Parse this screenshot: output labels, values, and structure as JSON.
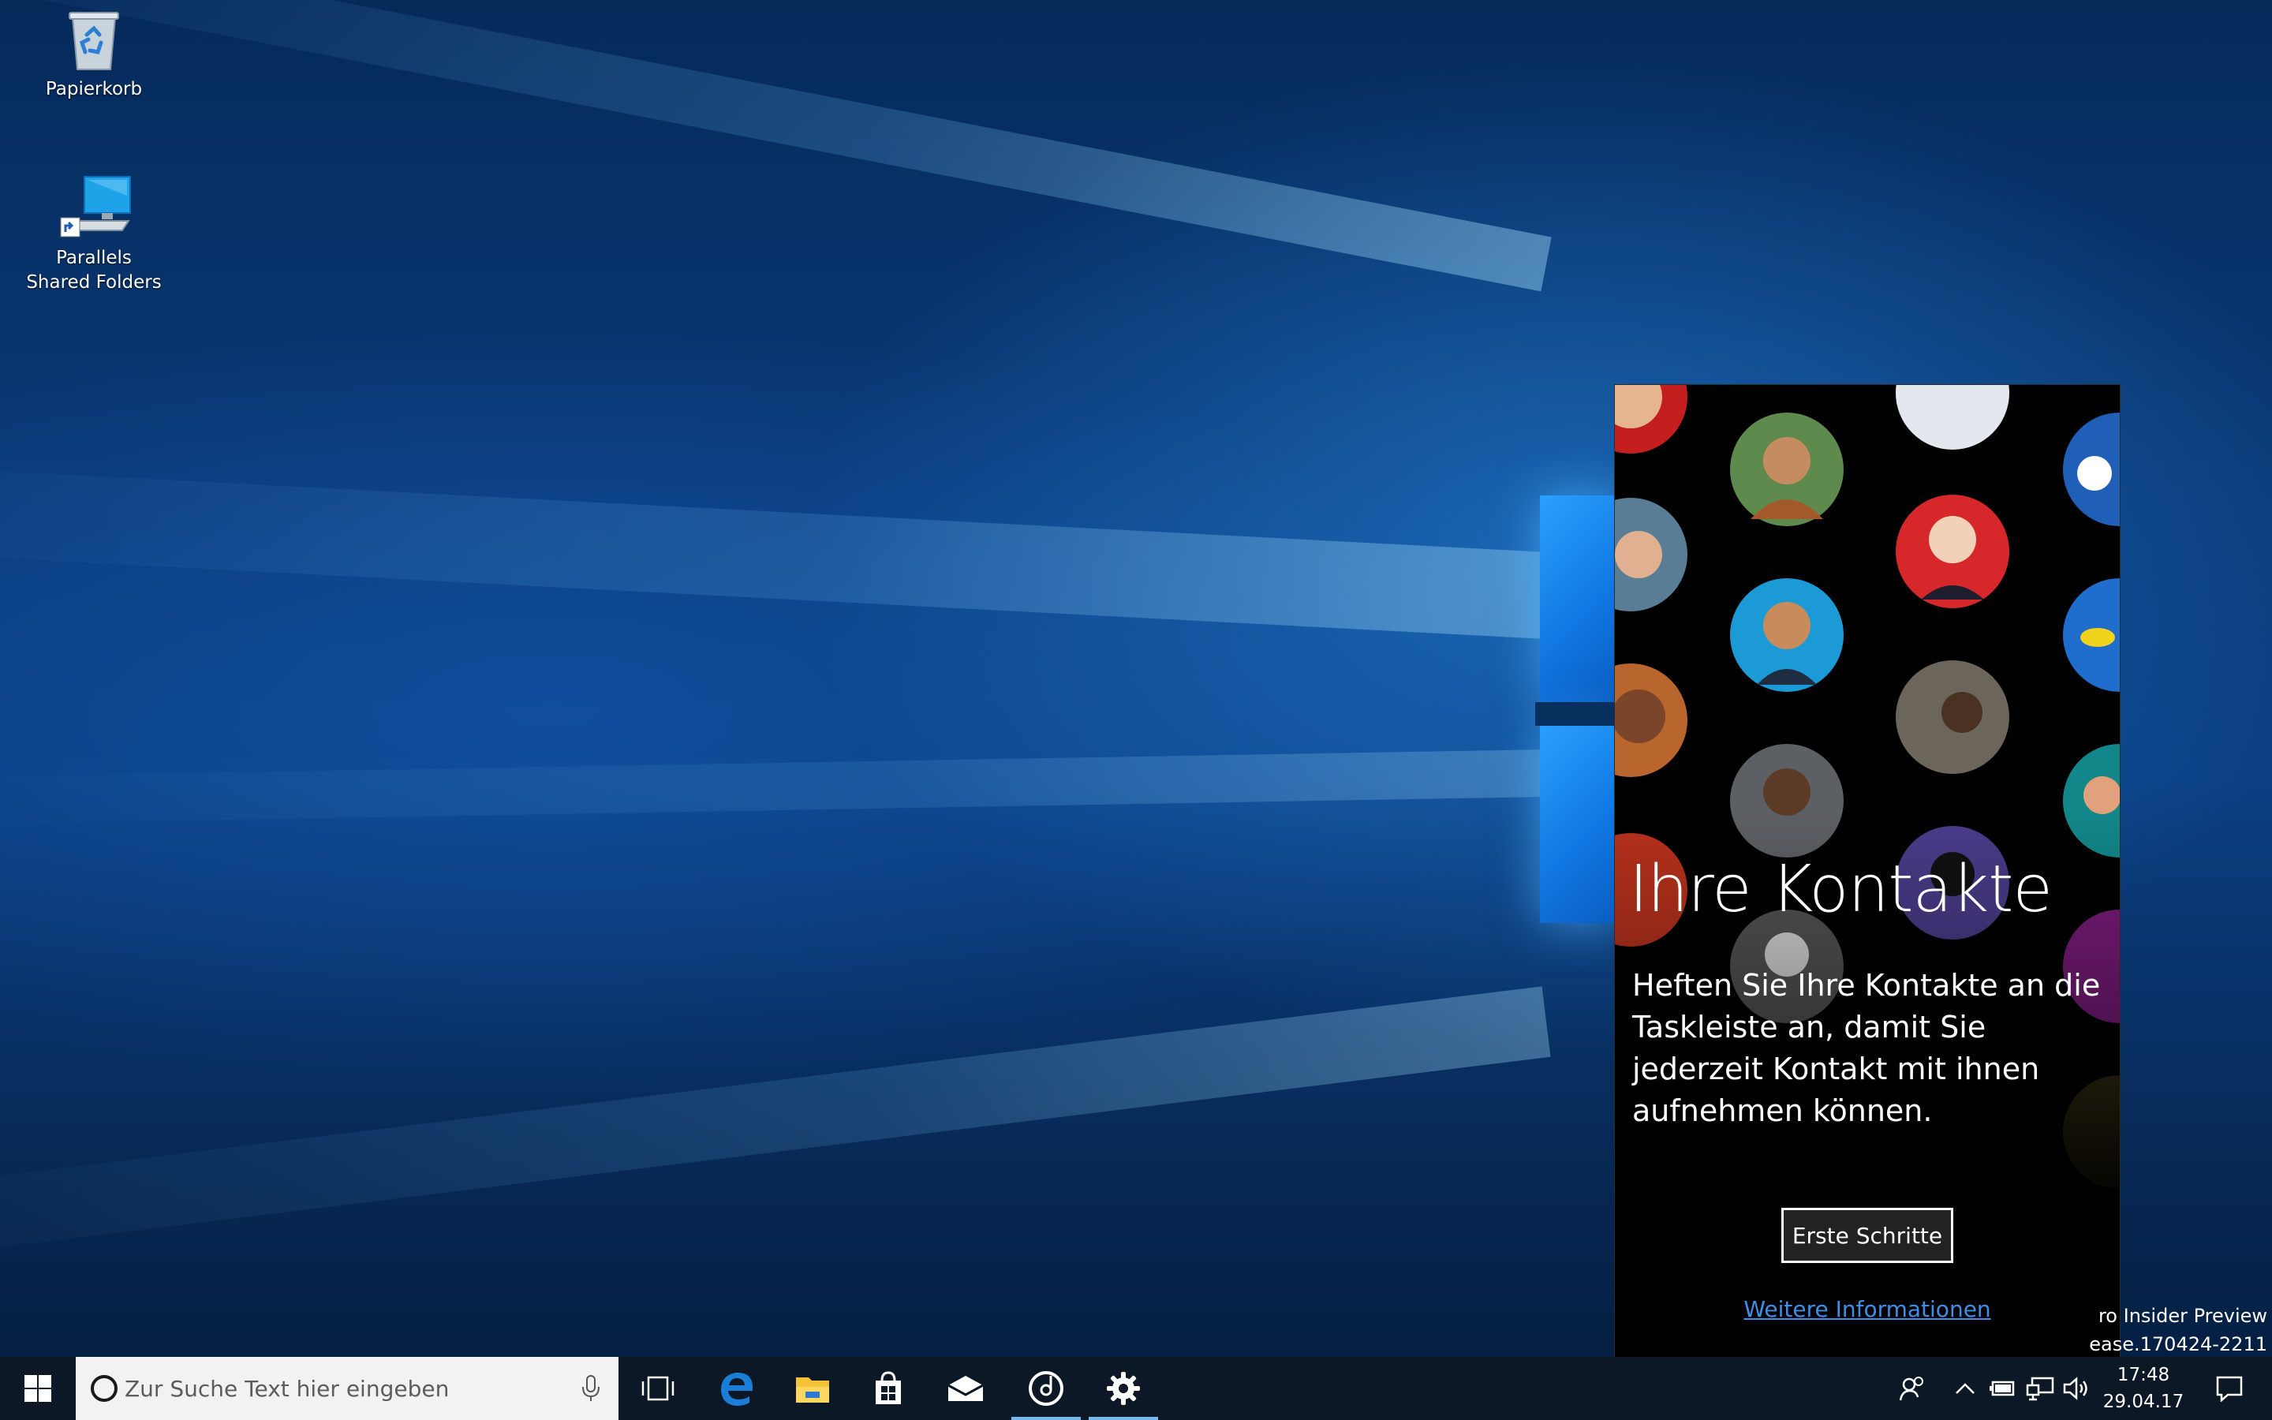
{
  "desktop": {
    "icons": [
      {
        "label": "Papierkorb",
        "icon": "recycle-bin-icon"
      },
      {
        "label": "Parallels Shared Folders",
        "icon": "shared-folders-icon"
      }
    ]
  },
  "people_flyout": {
    "title": "Ihre Kontakte",
    "description": "Heften Sie Ihre Kontakte an die Taskleiste an, damit Sie jederzeit Kontakt mit ihnen aufnehmen können.",
    "primary_button": "Erste Schritte",
    "link": "Weitere Informationen"
  },
  "watermark": {
    "line1": "ro Insider Preview",
    "line2": "ease.170424-2211"
  },
  "taskbar": {
    "search_placeholder": "Zur Suche Text hier eingeben",
    "pinned_apps": [
      "start-icon",
      "task-view-icon",
      "edge-icon",
      "file-explorer-icon",
      "store-icon",
      "mail-icon",
      "groove-music-icon",
      "settings-icon"
    ],
    "active_apps": [
      "groove-music-icon",
      "settings-icon"
    ],
    "tray_icons": [
      "people-icon",
      "chevron-up-icon",
      "battery-icon",
      "network-icon",
      "volume-icon",
      "action-center-icon"
    ],
    "time": "17:48",
    "date": "29.04.17"
  },
  "colors": {
    "taskbar": "#0c1826",
    "accent_underline": "#76b9ed",
    "link": "#3f8fe6",
    "wallpaper": "#0b3f82"
  }
}
